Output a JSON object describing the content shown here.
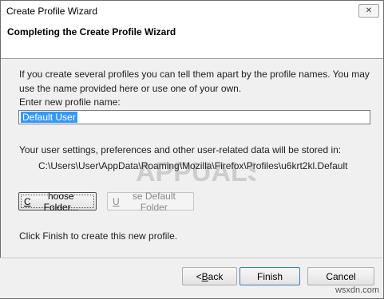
{
  "window": {
    "title": "Create Profile Wizard",
    "close_glyph": "✕"
  },
  "header": {
    "title": "Completing the Create Profile Wizard"
  },
  "main": {
    "intro": "If you create several profiles you can tell them apart by the profile names. You may use the name provided here or use one of your own.",
    "name_label": "Enter new profile name:",
    "name_value": "Default User",
    "storage_text": "Your user settings, preferences and other user-related data will be stored in:",
    "storage_path": "C:\\Users\\User\\AppData\\Roaming\\Mozilla\\Firefox\\Profiles\\u6krt2kl.Default",
    "choose_folder": {
      "pre": "",
      "key": "C",
      "post": "hoose Folder..."
    },
    "use_default_folder": {
      "pre": "",
      "key": "U",
      "post": "se Default Folder"
    },
    "finish_hint": "Click Finish to create this new profile."
  },
  "footer": {
    "back": {
      "pre": "< ",
      "key": "B",
      "post": "ack"
    },
    "finish": "Finish",
    "cancel": "Cancel"
  },
  "watermark": {
    "text": "APPUALS"
  },
  "site": "wsxdn.com"
}
